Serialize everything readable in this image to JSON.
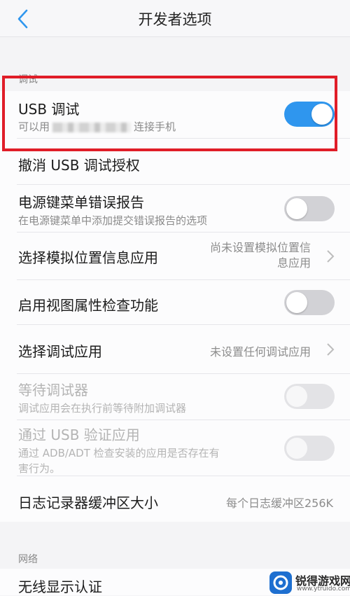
{
  "header": {
    "title": "开发者选项",
    "back_icon": "chevron-left-icon"
  },
  "sections": {
    "debug_label": "调试",
    "network_label": "网络"
  },
  "usb_debug": {
    "label": "USB 调试",
    "sub_prefix": "可以用",
    "sub_suffix": "连接手机",
    "on": true
  },
  "revoke": {
    "label": "撤消 USB 调试授权"
  },
  "power_bug": {
    "label": "电源键菜单错误报告",
    "sub": "在电源键菜单中添加提交错误报告的选项",
    "on": false
  },
  "mock_location": {
    "label": "选择模拟位置信息应用",
    "value_line1": "尚未设置模拟位置信",
    "value_line2": "息应用"
  },
  "view_attr": {
    "label": "启用视图属性检查功能",
    "on": false
  },
  "debug_app": {
    "label": "选择调试应用",
    "value": "未设置任何调试应用"
  },
  "wait_debugger": {
    "label": "等待调试器",
    "sub": "调试应用会在执行前等待附加调试器",
    "on": false,
    "disabled": true
  },
  "verify_usb": {
    "label": "通过 USB 验证应用",
    "sub_line1": "通过 ADB/ADT 检查安装的应用是否存在有",
    "sub_line2": "害行为。",
    "on": false,
    "disabled": true
  },
  "logger_buffer": {
    "label": "日志记录器缓冲区大小",
    "value": "每个日志缓冲区256K"
  },
  "wireless_display": {
    "label": "无线显示认证"
  },
  "watermark": {
    "text": "锐得游戏网",
    "url": "www.ytruido.com"
  },
  "colors": {
    "accent": "#2f96ee",
    "highlight": "#e01d28"
  }
}
